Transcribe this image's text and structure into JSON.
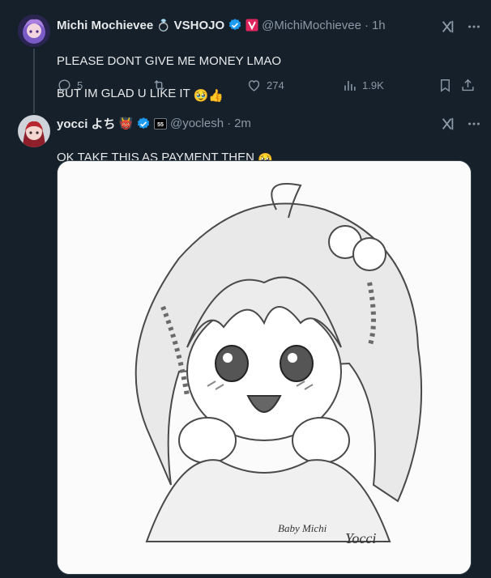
{
  "tweet1": {
    "name": "Michi Mochievee",
    "name_emoji": "💍",
    "affiliation": "VSHOJO",
    "handle": "@MichiMochievee",
    "dot": "·",
    "time": "1h",
    "line1": "PLEASE DONT GIVE ME MONEY LMAO",
    "line2": "BUT IM GLAD U LIKE IT",
    "line2_emojis": "🥹👍",
    "actions": {
      "replies": "5",
      "retweets": "",
      "likes": "274",
      "views": "1.9K"
    }
  },
  "tweet2": {
    "name": "yocci よち",
    "name_emoji": "👹",
    "handle": "@yoclesh",
    "dot": "·",
    "time": "2m",
    "text": "OK TAKE THIS AS PAYMENT THEN",
    "text_emoji": "🥹",
    "signature": "Baby Michi",
    "signature_artist": "Yocci"
  },
  "colors": {
    "background": "#15202b",
    "text": "#e7e9ea",
    "muted": "#8b98a5",
    "verified": "#1d9bf0",
    "vshojo_pink": "#e0245e"
  },
  "icons": [
    "grok-icon",
    "more-icon",
    "reply-icon",
    "retweet-icon",
    "like-icon",
    "views-icon",
    "bookmark-icon",
    "share-icon",
    "verified-icon"
  ]
}
